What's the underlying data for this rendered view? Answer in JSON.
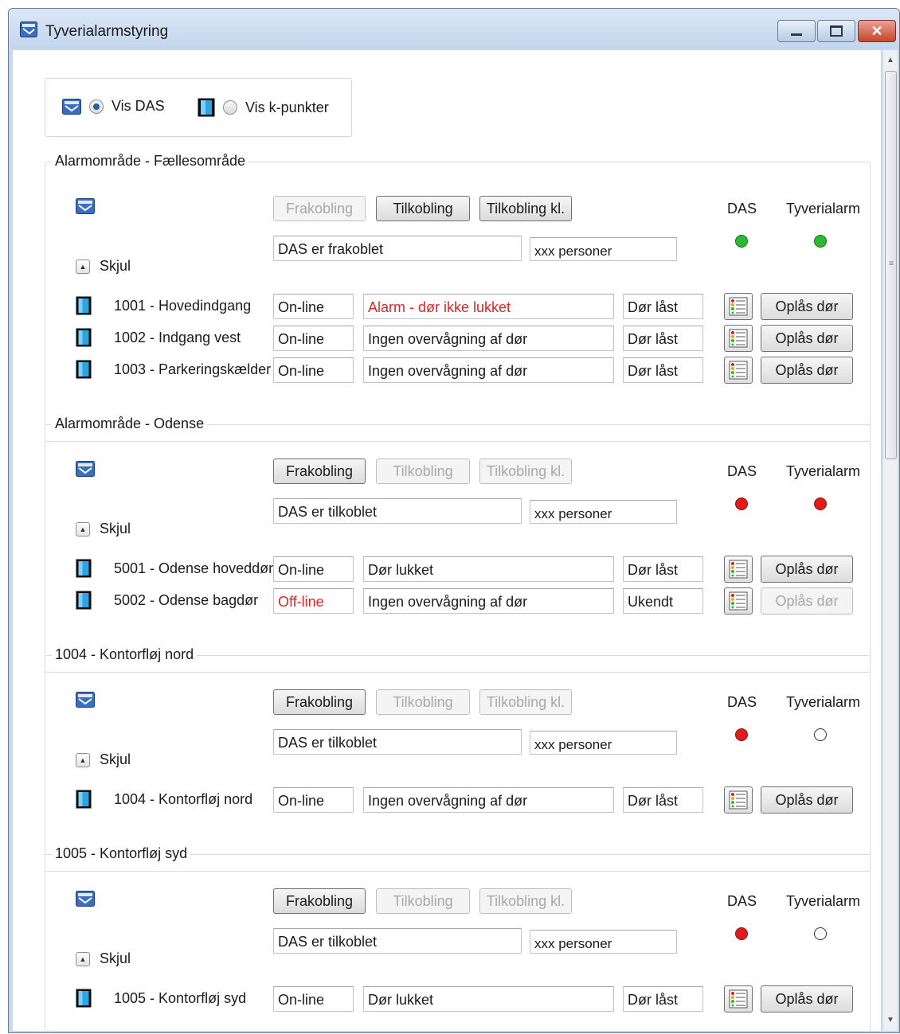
{
  "window": {
    "title": "Tyverialarmstyring",
    "controls": [
      "minimize",
      "maximize",
      "close"
    ]
  },
  "view": {
    "das_label": "Vis DAS",
    "kpunkter_label": "Vis k-punkter",
    "selected": "Vis DAS"
  },
  "common": {
    "frakobling": "Frakobling",
    "tilkobling": "Tilkobling",
    "tilkobling_kl": "Tilkobling kl.",
    "das_header": "DAS",
    "alarm_header": "Tyverialarm",
    "skjul": "Skjul",
    "personer": "xxx personer",
    "unlock": "Oplås dør"
  },
  "colors": {
    "green": "#2eb82e",
    "red": "#e01c1c",
    "alarm_text": "#e02424"
  },
  "groups": [
    {
      "title": "Alarmområde - Fællesområde",
      "status": "DAS er frakoblet",
      "das_led": "green",
      "alarm_led": "green",
      "enabled_buttons": [
        "tilkobling",
        "tilkobling_kl"
      ],
      "doors": [
        {
          "name": "1001 - Hovedindgang",
          "online": "On-line",
          "state": "Alarm - dør ikke lukket",
          "lock": "Dør låst",
          "state_alert": true
        },
        {
          "name": "1002 - Indgang vest",
          "online": "On-line",
          "state": "Ingen overvågning af dør",
          "lock": "Dør låst"
        },
        {
          "name": "1003 - Parkeringskælder",
          "online": "On-line",
          "state": "Ingen overvågning af dør",
          "lock": "Dør låst"
        }
      ]
    },
    {
      "title": "Alarmområde - Odense",
      "status": "DAS er tilkoblet",
      "das_led": "red",
      "alarm_led": "red",
      "enabled_buttons": [
        "frakobling"
      ],
      "doors": [
        {
          "name": "5001 - Odense hoveddør",
          "online": "On-line",
          "state": "Dør lukket",
          "lock": "Dør låst"
        },
        {
          "name": "5002 - Odense bagdør",
          "online": "Off-line",
          "state": "Ingen overvågning af dør",
          "lock": "Ukendt",
          "online_alert": true,
          "unlock_disabled": true
        }
      ]
    },
    {
      "title": "1004 - Kontorfløj nord",
      "status": "DAS er tilkoblet",
      "das_led": "red",
      "alarm_led": "off",
      "enabled_buttons": [
        "frakobling"
      ],
      "doors": [
        {
          "name": "1004 - Kontorfløj nord",
          "online": "On-line",
          "state": "Ingen overvågning af dør",
          "lock": "Dør låst"
        }
      ]
    },
    {
      "title": "1005 - Kontorfløj syd",
      "status": "DAS er tilkoblet",
      "das_led": "red",
      "alarm_led": "off",
      "enabled_buttons": [
        "frakobling"
      ],
      "doors": [
        {
          "name": "1005 - Kontorfløj syd",
          "online": "On-line",
          "state": "Dør lukket",
          "lock": "Dør låst"
        }
      ]
    }
  ]
}
